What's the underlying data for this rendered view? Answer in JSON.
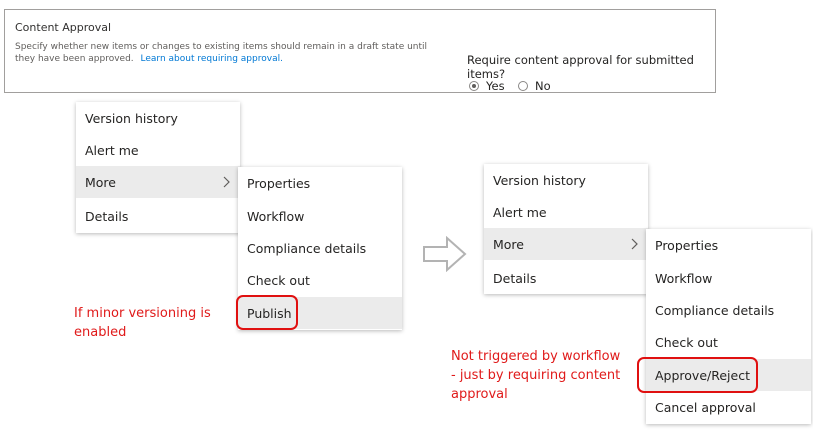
{
  "settings": {
    "title": "Content Approval",
    "description": "Specify whether new items or changes to existing items should remain in a draft state until they have been approved.",
    "learn_link": "Learn about requiring approval.",
    "question": "Require content approval for submitted items?",
    "options": [
      {
        "label": "Yes",
        "selected": true
      },
      {
        "label": "No",
        "selected": false
      }
    ]
  },
  "left_menu": {
    "items": [
      "Version history",
      "Alert me",
      "More",
      "Details"
    ],
    "submenu": [
      "Properties",
      "Workflow",
      "Compliance details",
      "Check out",
      "Publish"
    ]
  },
  "right_menu": {
    "items": [
      "Version history",
      "Alert me",
      "More",
      "Details"
    ],
    "submenu": [
      "Properties",
      "Workflow",
      "Compliance details",
      "Check out",
      "Approve/Reject",
      "Cancel approval"
    ]
  },
  "notes": {
    "left_line1": "If minor versioning is",
    "left_line2": "enabled",
    "right_line1": "Not triggered by workflow",
    "right_line2": "- just by requiring content",
    "right_line3": "approval"
  },
  "icons": {
    "chevron": "chevron-right-icon",
    "arrow": "arrow-right-outline-icon"
  },
  "colors": {
    "annotation_red": "#e01a1a",
    "hover_bg": "#ebebeb",
    "link": "#0078d4"
  }
}
